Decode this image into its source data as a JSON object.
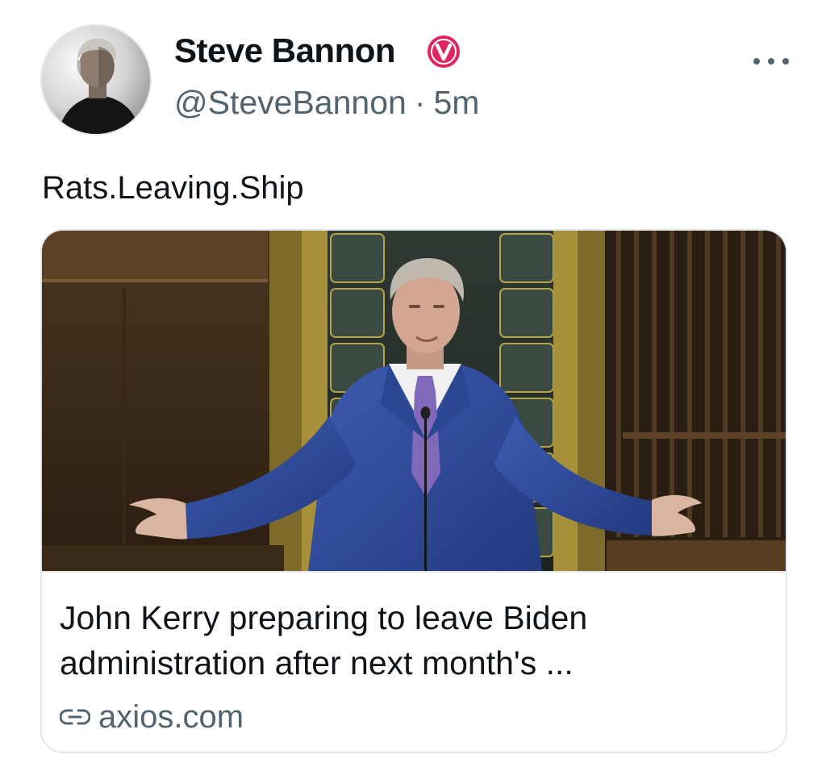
{
  "post": {
    "author": {
      "display_name": "Steve Bannon",
      "handle": "@SteveBannon",
      "verified_icon": "verified-badge-icon",
      "verified_color": "#e0245e"
    },
    "separator": "·",
    "timestamp": "5m",
    "more_icon": "more-options-icon",
    "text": "Rats.Leaving.Ship",
    "card": {
      "title_line_1": "John Kerry preparing to leave Biden",
      "title_line_2": "administration after next month's ...",
      "link_icon": "link-icon",
      "domain": "axios.com"
    }
  },
  "colors": {
    "text_primary": "#0f1419",
    "text_secondary": "#536471",
    "border": "#e1e8ed",
    "badge_red": "#e0245e"
  }
}
